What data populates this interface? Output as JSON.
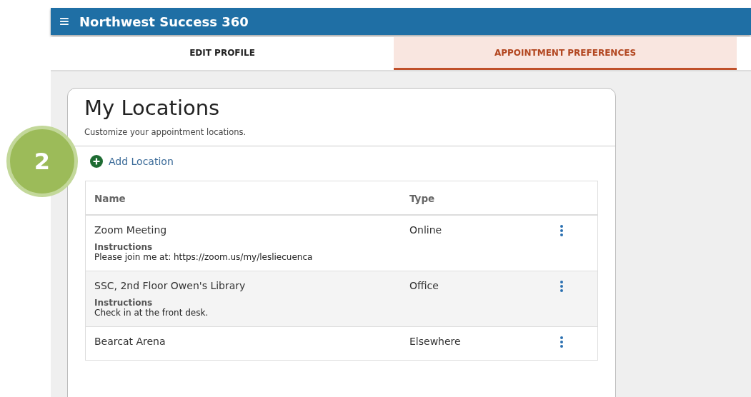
{
  "app_bar": {
    "menu_icon": "≡",
    "title": "Northwest Success 360"
  },
  "tabs": [
    {
      "label": "EDIT PROFILE",
      "selected": false
    },
    {
      "label": "APPOINTMENT PREFERENCES",
      "selected": true
    }
  ],
  "step_badge": "2",
  "card": {
    "title": "My Locations",
    "subtitle": "Customize your appointment locations.",
    "add_link": "Add Location",
    "table": {
      "columns": [
        "Name",
        "Type"
      ],
      "rows": [
        {
          "name": "Zoom Meeting",
          "type": "Online",
          "instructions_label": "Instructions",
          "instructions": "Please join me at: https://zoom.us/my/lesliecuenca"
        },
        {
          "name": "SSC, 2nd Floor Owen's Library",
          "type": "Office",
          "instructions_label": "Instructions",
          "instructions": "Check in at the front desk."
        },
        {
          "name": "Bearcat Arena",
          "type": "Elsewhere"
        }
      ]
    }
  }
}
